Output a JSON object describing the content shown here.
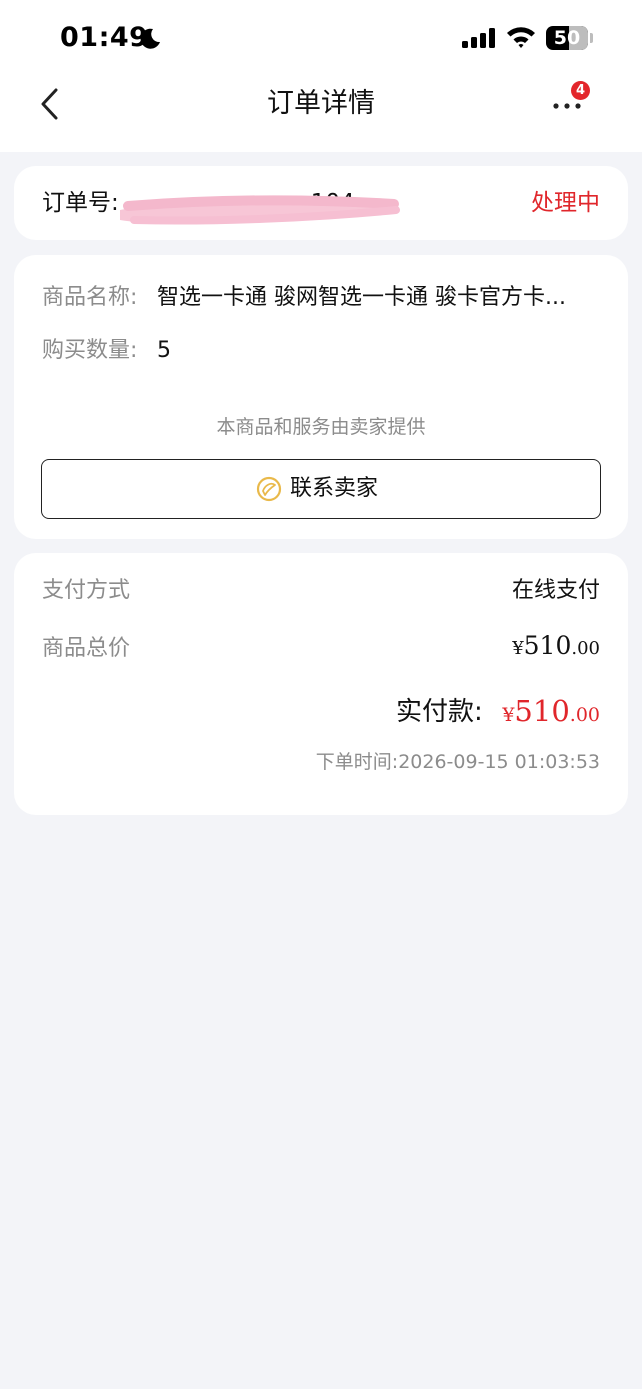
{
  "status_bar": {
    "time": "01:49",
    "battery": "50"
  },
  "nav": {
    "title": "订单详情",
    "more_badge": "4"
  },
  "order": {
    "number_label": "订单号:",
    "number_suffix": "104",
    "status": "处理中",
    "status_color": "#e0262b"
  },
  "product": {
    "name_label": "商品名称:",
    "name_value": "智选一卡通 骏网智选一卡通 骏卡官方卡...",
    "quantity_label": "购买数量:",
    "quantity_value": "5",
    "provider_note": "本商品和服务由卖家提供",
    "contact_button": "联系卖家"
  },
  "payment": {
    "method_label": "支付方式",
    "method_value": "在线支付",
    "total_label": "商品总价",
    "total_currency": "¥",
    "total_int": "510",
    "total_dec": ".00",
    "paid_label": "实付款:",
    "paid_currency": "¥",
    "paid_int": "510",
    "paid_dec": ".00",
    "order_time": "下单时间:2026-09-15 01:03:53"
  },
  "colors": {
    "accent_red": "#e0262b",
    "background": "#f3f4f8",
    "seller_icon": "#e9b94a"
  }
}
